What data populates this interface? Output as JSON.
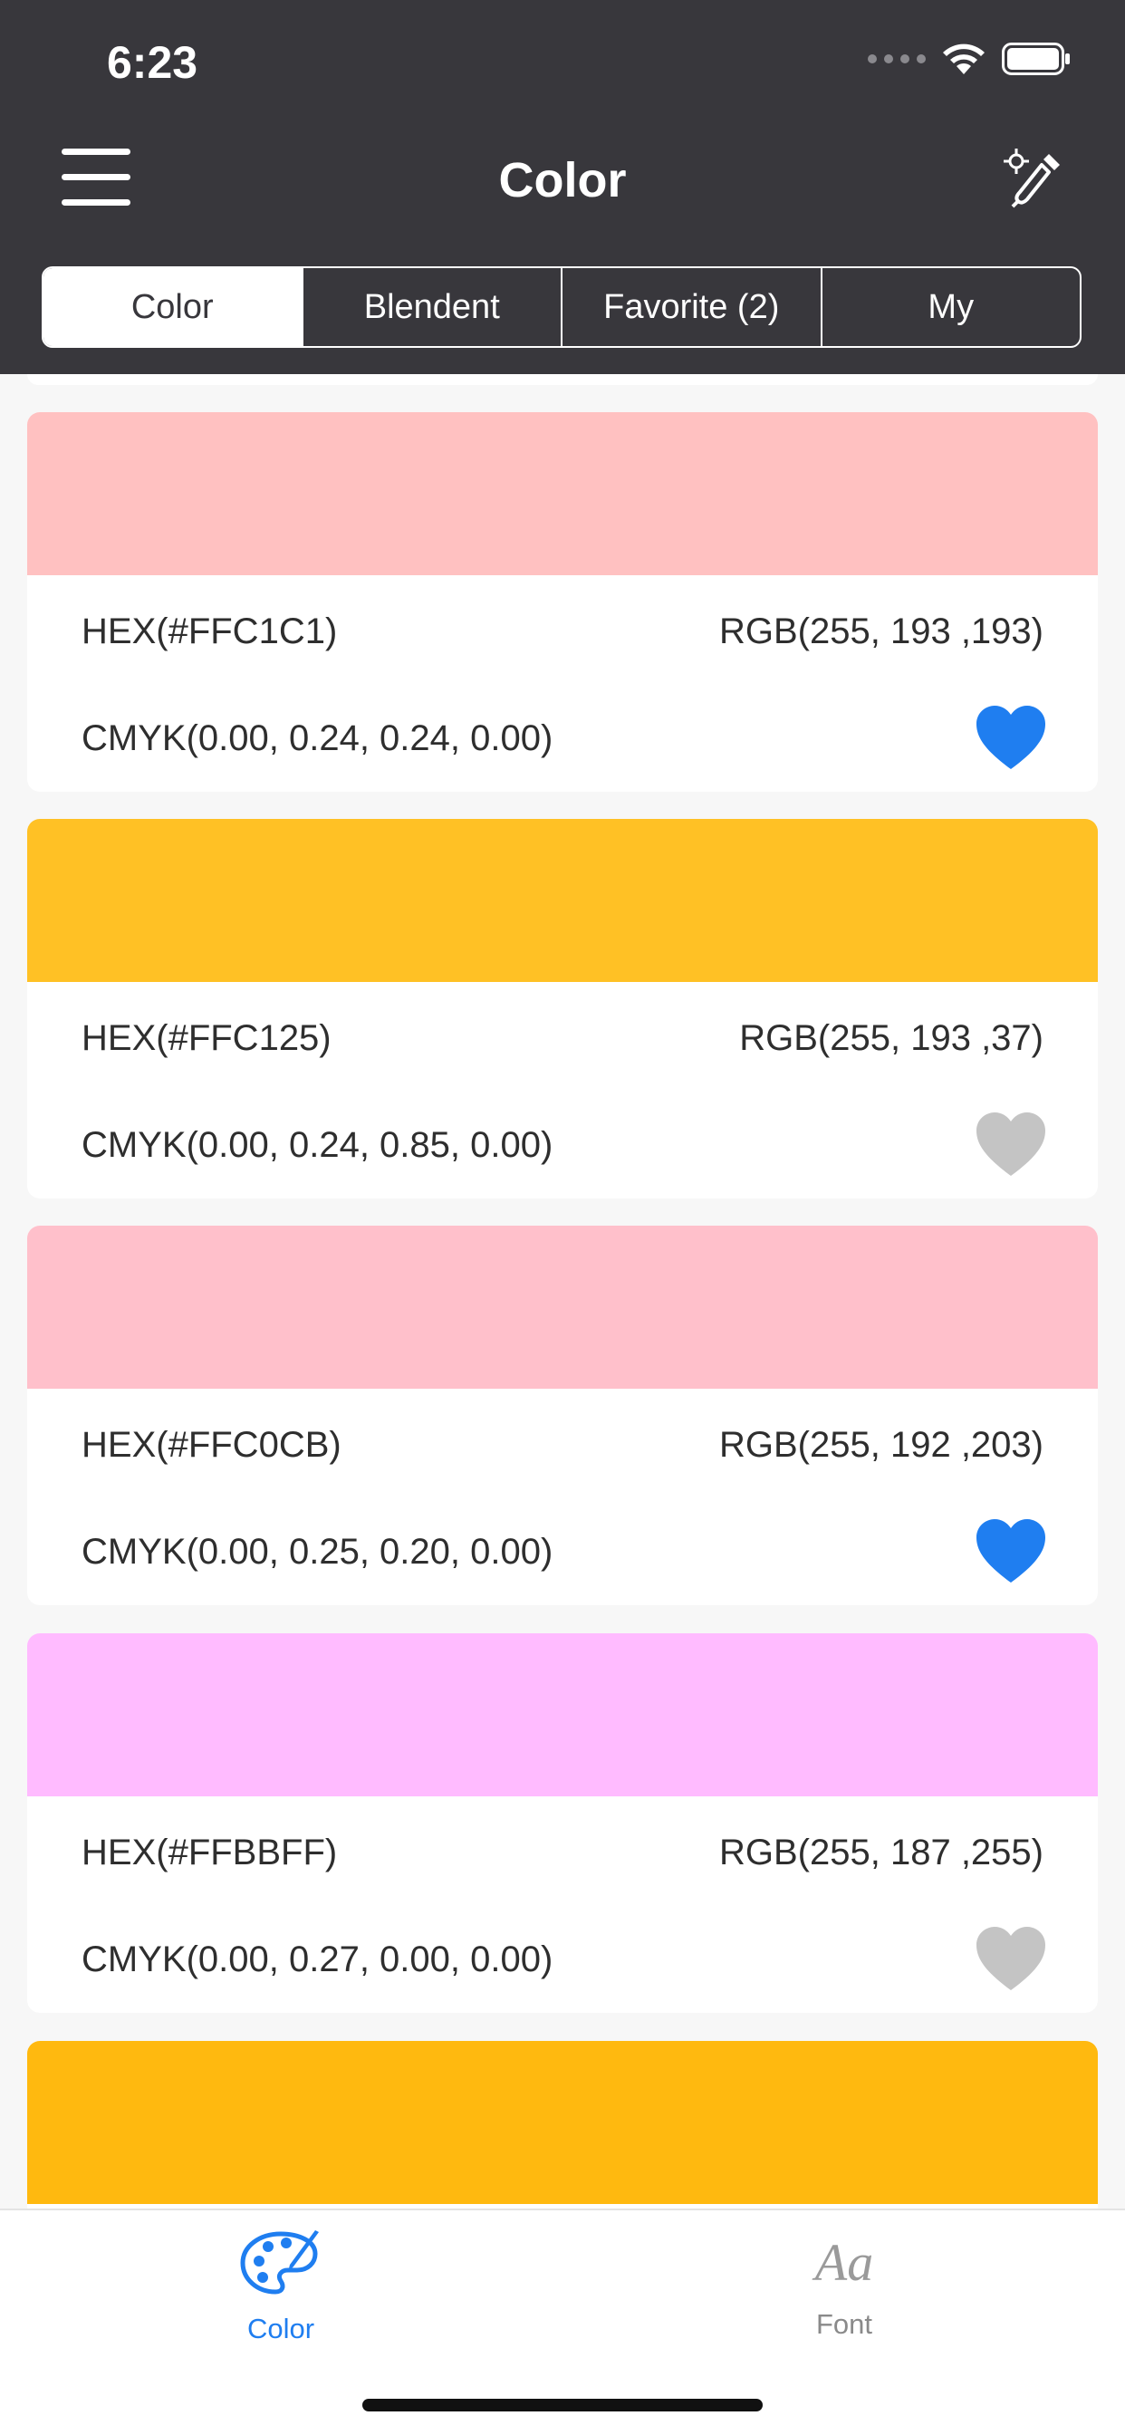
{
  "status_bar": {
    "time": "6:23"
  },
  "header": {
    "title": "Color",
    "tabs": [
      {
        "label": "Color",
        "active": true
      },
      {
        "label": "Blendent",
        "active": false
      },
      {
        "label": "Favorite (2)",
        "active": false
      },
      {
        "label": "My",
        "active": false
      }
    ]
  },
  "colors": [
    {
      "swatch": "#FFC1C1",
      "hex": "HEX(#FFC1C1)",
      "rgb": "RGB(255, 193 ,193)",
      "cmyk": "CMYK(0.00, 0.24, 0.24, 0.00)",
      "favorite": true
    },
    {
      "swatch": "#FFC125",
      "hex": "HEX(#FFC125)",
      "rgb": "RGB(255, 193 ,37)",
      "cmyk": "CMYK(0.00, 0.24, 0.85, 0.00)",
      "favorite": false
    },
    {
      "swatch": "#FFC0CB",
      "hex": "HEX(#FFC0CB)",
      "rgb": "RGB(255, 192 ,203)",
      "cmyk": "CMYK(0.00, 0.25, 0.20, 0.00)",
      "favorite": true
    },
    {
      "swatch": "#FFBBFF",
      "hex": "HEX(#FFBBFF)",
      "rgb": "RGB(255, 187 ,255)",
      "cmyk": "CMYK(0.00, 0.27, 0.00, 0.00)",
      "favorite": false
    },
    {
      "swatch": "#FFB90F"
    }
  ],
  "theme": {
    "accent": "#1F7EF0",
    "header_bg": "#38373C",
    "heart_off": "#C4C4C4"
  },
  "tabbar": {
    "items": [
      {
        "label": "Color",
        "icon": "palette-icon",
        "active": true
      },
      {
        "label": "Font",
        "icon": "font-aa-icon",
        "active": false
      }
    ]
  }
}
